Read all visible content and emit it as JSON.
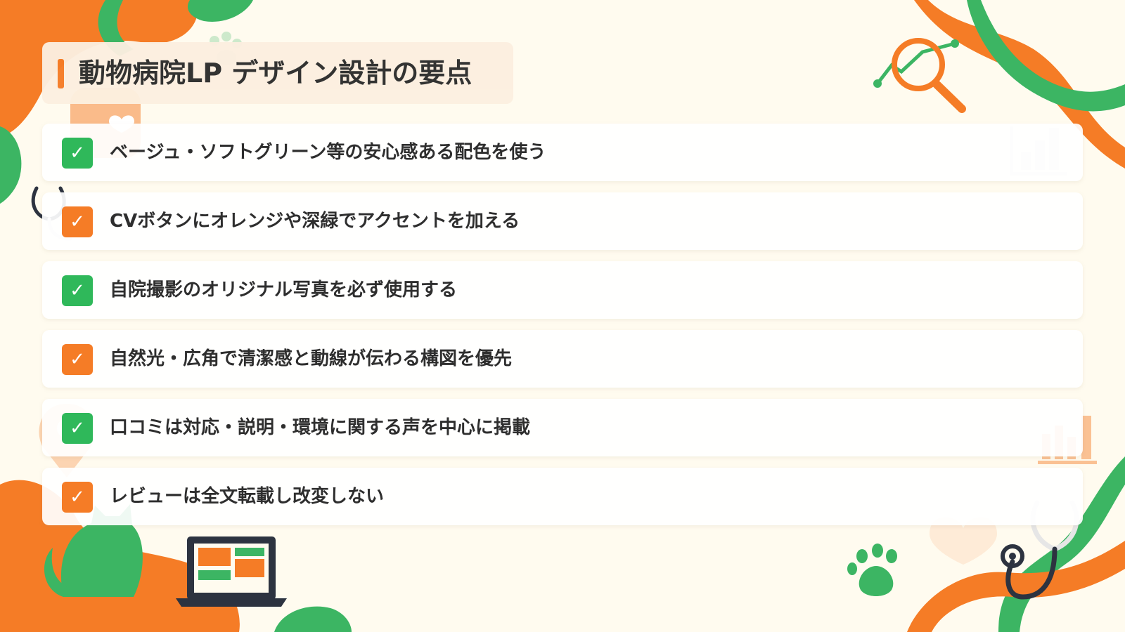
{
  "title": "動物病院LP デザイン設計の要点",
  "items": [
    {
      "text": "ベージュ・ソフトグリーン等の安心感ある配色を使う",
      "check": "✓",
      "color": "green"
    },
    {
      "text": "CVボタンにオレンジや深緑でアクセントを加える",
      "check": "✓",
      "color": "orange"
    },
    {
      "text": "自院撮影のオリジナル写真を必ず使用する",
      "check": "✓",
      "color": "green"
    },
    {
      "text": "自然光・広角で清潔感と動線が伝わる構図を優先",
      "check": "✓",
      "color": "orange"
    },
    {
      "text": "口コミは対応・説明・環境に関する声を中心に掲載",
      "check": "✓",
      "color": "green"
    },
    {
      "text": "レビューは全文転載し改変しない",
      "check": "✓",
      "color": "orange"
    }
  ],
  "colors": {
    "background": "#fffbef",
    "accent_orange": "#f57c26",
    "accent_green": "#2fb85a",
    "text": "#2e2e2e"
  },
  "decor_icons": [
    "paw-icon",
    "heart-icon",
    "stethoscope-icon",
    "magnifier-chart-icon",
    "bar-chart-icon",
    "laptop-icon",
    "cat-silhouette-icon",
    "map-pin-icon"
  ]
}
